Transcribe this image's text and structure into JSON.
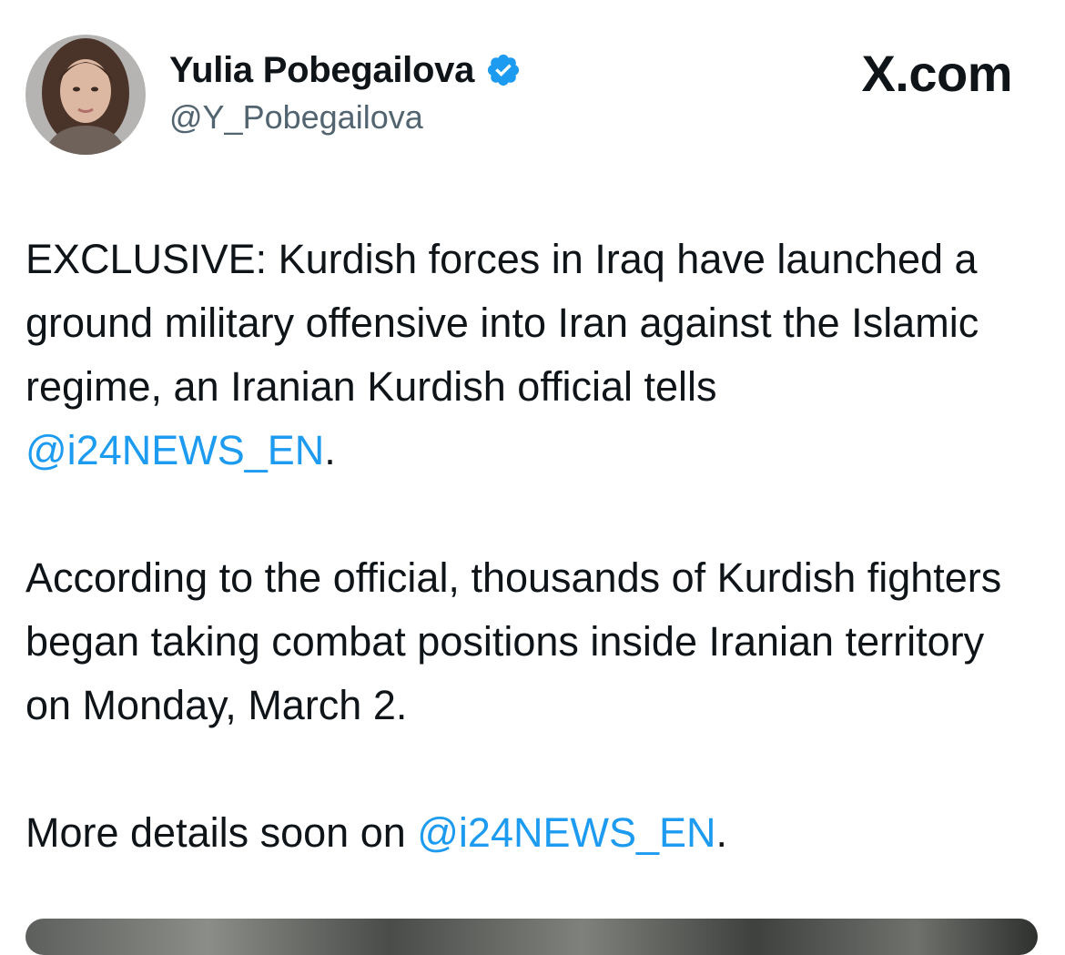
{
  "author": {
    "display_name": "Yulia Pobegailova",
    "handle": "@Y_Pobegailova",
    "verified": true,
    "verified_color": "#1d9bf0",
    "avatar_icon": "profile-photo"
  },
  "brand": {
    "label": "X.com"
  },
  "tweet": {
    "paragraphs": [
      {
        "text": "EXCLUSIVE: Kurdish forces in Iraq have launched a ground military offensive into Iran against the Islamic regime, an Iranian Kurdish official tells ",
        "mention": "@i24NEWS_EN",
        "after": "."
      },
      {
        "text": "According to the official, thousands of Kurdish fighters began taking combat positions inside Iranian territory on Monday, March 2."
      },
      {
        "text": "More details soon on ",
        "mention": "@i24NEWS_EN",
        "after": "."
      }
    ],
    "mention_color": "#1d9bf0",
    "media": "image-preview"
  }
}
